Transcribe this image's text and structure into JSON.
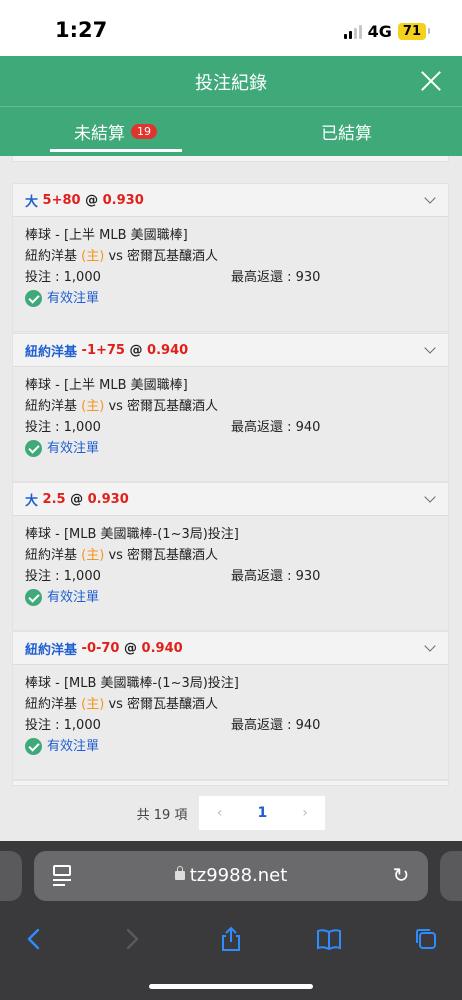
{
  "status": {
    "time": "1:27",
    "network": "4G",
    "battery": "71"
  },
  "header": {
    "title": "投注紀錄"
  },
  "tabs": [
    {
      "label": "未結算",
      "badge": "19",
      "active": true
    },
    {
      "label": "已結算",
      "active": false
    }
  ],
  "bets": [
    {
      "head": {
        "selection": "大",
        "line": "5+80",
        "at": "@",
        "odds": "0.930"
      },
      "league": "棒球 - [上半 MLB 美國職棒]",
      "home_team": "紐約洋基",
      "home_tag": "(主)",
      "vs_text": "vs 密爾瓦基釀酒人",
      "stake": "投注 : 1,000",
      "max_return": "最高返還 : 930",
      "status": "有效注單"
    },
    {
      "head": {
        "selection": "紐約洋基",
        "line": "-1+75",
        "at": "@",
        "odds": "0.940"
      },
      "league": "棒球 - [上半 MLB 美國職棒]",
      "home_team": "紐約洋基",
      "home_tag": "(主)",
      "vs_text": "vs 密爾瓦基釀酒人",
      "stake": "投注 : 1,000",
      "max_return": "最高返還 : 940",
      "status": "有效注單"
    },
    {
      "head": {
        "selection": "大",
        "line": "2.5",
        "at": "@",
        "odds": "0.930"
      },
      "league": "棒球 - [MLB 美國職棒-(1~3局)投注]",
      "home_team": "紐約洋基",
      "home_tag": "(主)",
      "vs_text": "vs 密爾瓦基釀酒人",
      "stake": "投注 : 1,000",
      "max_return": "最高返還 : 930",
      "status": "有效注單"
    },
    {
      "head": {
        "selection": "紐約洋基",
        "line": "-0-70",
        "at": "@",
        "odds": "0.940"
      },
      "league": "棒球 - [MLB 美國職棒-(1~3局)投注]",
      "home_team": "紐約洋基",
      "home_tag": "(主)",
      "vs_text": "vs 密爾瓦基釀酒人",
      "stake": "投注 : 1,000",
      "max_return": "最高返還 : 940",
      "status": "有效注單"
    }
  ],
  "pager": {
    "total": "共 19 項",
    "prev": "‹",
    "current": "1",
    "next": "›"
  },
  "browser": {
    "url": "tz9988.net"
  },
  "colors": {
    "accent": "#3fa97a",
    "badge": "#e0342f",
    "link": "#1f5fd1",
    "odds": "#e0201b",
    "home_tag": "#f5941f"
  }
}
